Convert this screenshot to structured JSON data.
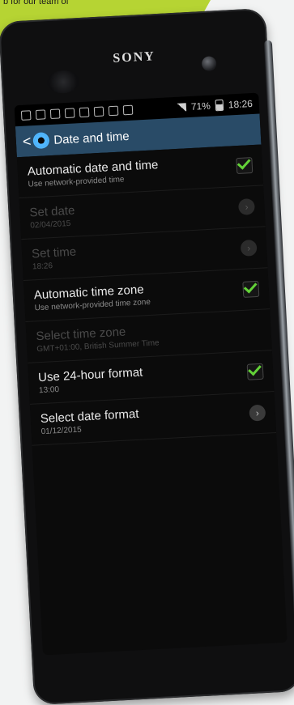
{
  "magazine": {
    "text": "b for our team of"
  },
  "phone": {
    "brand": "SONY"
  },
  "statusbar": {
    "battery": "71%",
    "time": "18:26"
  },
  "actionbar": {
    "back": "<",
    "title": "Date and time"
  },
  "settings": {
    "items": [
      {
        "title": "Automatic date and time",
        "subtitle": "Use network-provided time"
      },
      {
        "title": "Set date",
        "subtitle": "02/04/2015"
      },
      {
        "title": "Set time",
        "subtitle": "18:26"
      },
      {
        "title": "Automatic time zone",
        "subtitle": "Use network-provided time zone"
      },
      {
        "title": "Select time zone",
        "subtitle": "GMT+01:00, British Summer Time"
      },
      {
        "title": "Use 24-hour format",
        "subtitle": "13:00"
      },
      {
        "title": "Select date format",
        "subtitle": "01/12/2015"
      }
    ]
  },
  "colors": {
    "accent": "#294b67",
    "check": "#63d238"
  },
  "icons": {
    "status_left": [
      "tango-icon",
      "screenshot-icon",
      "calendar-icon",
      "mail-icon",
      "message-icon",
      "facebook-icon",
      "edit-icon",
      "app-icon"
    ],
    "status_right": [
      "wifi-icon",
      "signal-icon",
      "battery-icon"
    ],
    "back": "back-arrow-icon",
    "settings": "gear-icon",
    "check": "check-icon",
    "chevron": "chevron-right-icon"
  }
}
